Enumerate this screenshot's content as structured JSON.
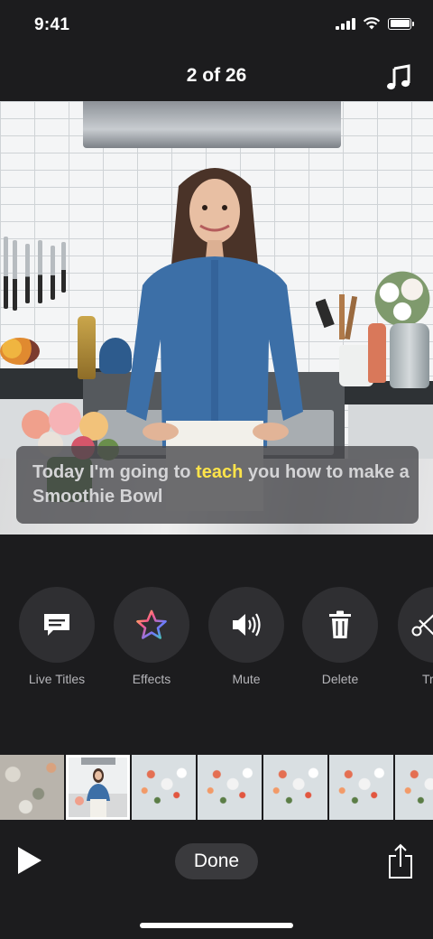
{
  "status_bar": {
    "time": "9:41",
    "signal_icon": "cellular-signal-icon",
    "wifi_icon": "wifi-icon",
    "battery_icon": "battery-icon"
  },
  "nav": {
    "title": "2 of 26",
    "music_icon": "music-note-icon"
  },
  "video": {
    "caption_before": "Today I'm going to ",
    "caption_highlight": "teach",
    "caption_after": " you how to make a Smoothie Bowl",
    "highlight_color": "#ffe44a"
  },
  "tools": [
    {
      "label": "Live Titles",
      "icon": "speech-bubble-icon"
    },
    {
      "label": "Effects",
      "icon": "star-icon"
    },
    {
      "label": "Mute",
      "icon": "speaker-icon"
    },
    {
      "label": "Delete",
      "icon": "trash-icon"
    },
    {
      "label": "Tr",
      "icon": "scissors-icon"
    }
  ],
  "timeline": {
    "clip_count_visible": 7,
    "selected_index": 1
  },
  "bottom": {
    "play_icon": "play-icon",
    "done_label": "Done",
    "share_icon": "share-icon"
  }
}
